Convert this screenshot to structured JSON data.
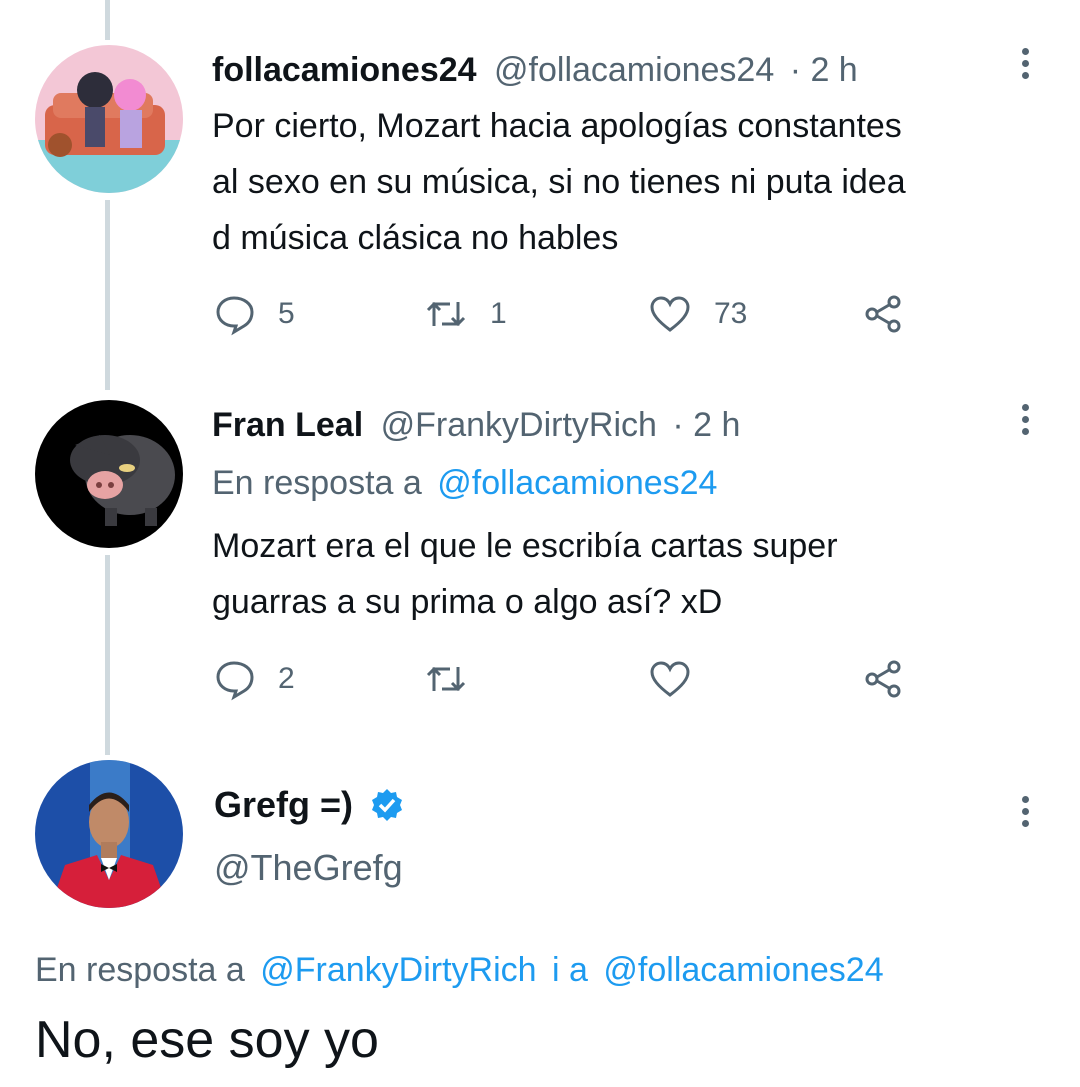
{
  "tweets": [
    {
      "display_name": "follacamiones24",
      "handle": "@follacamiones24",
      "time": "· 2 h",
      "text_lines": [
        "Por cierto, Mozart hacia apologías constantes",
        "al sexo en su música, si no tienes ni puta idea",
        "d música clásica no hables"
      ],
      "replies": "5",
      "retweets": "1",
      "likes": "73"
    },
    {
      "display_name": "Fran Leal",
      "handle": "@FrankyDirtyRich",
      "time": "· 2 h",
      "reply_prefix": "En resposta a",
      "reply_to": "@follacamiones24",
      "text_lines": [
        "Mozart era el que le escribía cartas super",
        "guarras a su prima o algo así? xD"
      ],
      "replies": "2"
    },
    {
      "display_name": "Grefg =)",
      "handle": "@TheGrefg",
      "verified": true,
      "reply_prefix": "En resposta a",
      "reply_to_1": "@FrankyDirtyRich",
      "reply_joiner": "i a",
      "reply_to_2": "@follacamiones24",
      "text": "No, ese soy yo"
    }
  ],
  "colors": {
    "text": "#0f1419",
    "muted": "#536471",
    "link": "#1d9bf0",
    "thread_line": "#cfd9de"
  },
  "icons": [
    "reply-icon",
    "retweet-icon",
    "like-icon",
    "share-icon",
    "more-options-icon",
    "verified-badge-icon"
  ]
}
